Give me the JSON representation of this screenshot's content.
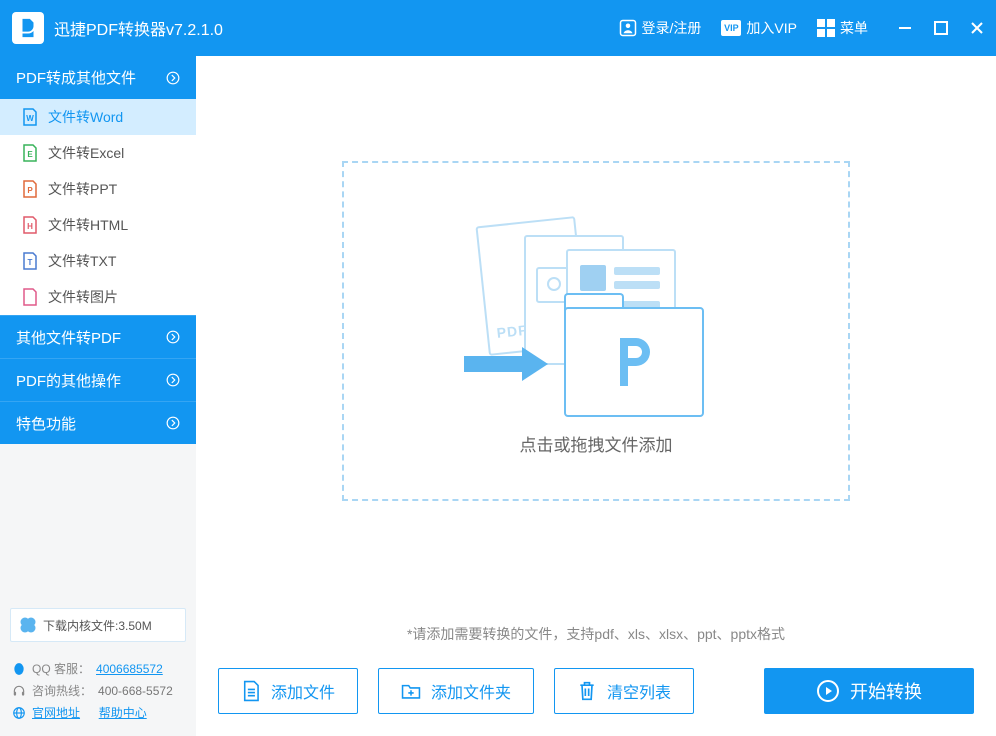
{
  "app_title": "迅捷PDF转换器v7.2.1.0",
  "titlebar": {
    "login": "登录/注册",
    "vip": "加入VIP",
    "menu": "菜单"
  },
  "sidebar": {
    "sections": [
      {
        "label": "PDF转成其他文件"
      },
      {
        "label": "其他文件转PDF"
      },
      {
        "label": "PDF的其他操作"
      },
      {
        "label": "特色功能"
      }
    ],
    "items": [
      {
        "label": "文件转Word",
        "color": "#1296f1",
        "letter": "W"
      },
      {
        "label": "文件转Excel",
        "color": "#38b35a",
        "letter": "E"
      },
      {
        "label": "文件转PPT",
        "color": "#e06a3b",
        "letter": "P"
      },
      {
        "label": "文件转HTML",
        "color": "#e05a6a",
        "letter": "H"
      },
      {
        "label": "文件转TXT",
        "color": "#4a7bd1",
        "letter": "T"
      },
      {
        "label": "文件转图片",
        "color": "#e05a8a",
        "letter": ""
      }
    ],
    "download": "下载内核文件:3.50M",
    "support": {
      "qq_label": "QQ 客服：",
      "qq_value": "4006685572",
      "hotline_label": "咨询热线：",
      "hotline_value": "400-668-5572",
      "site": "官网地址",
      "help": "帮助中心"
    }
  },
  "main": {
    "drop_label": "点击或拖拽文件添加",
    "hint": "*请添加需要转换的文件，支持pdf、xls、xlsx、ppt、pptx格式"
  },
  "buttons": {
    "add_file": "添加文件",
    "add_folder": "添加文件夹",
    "clear": "清空列表",
    "start": "开始转换"
  }
}
